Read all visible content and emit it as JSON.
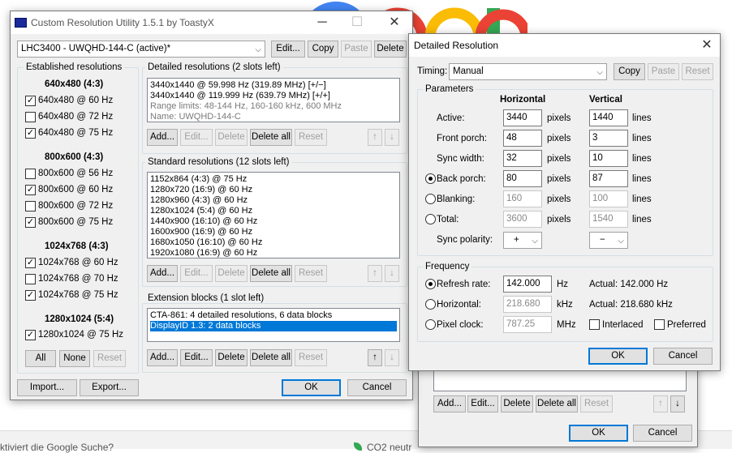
{
  "background": {
    "page_fragment_left": "ktiviert die Google Suche?",
    "page_fragment_right": "CO2 neutr"
  },
  "main": {
    "title": "Custom Resolution Utility 1.5.1 by ToastyX",
    "display": "LHC3400 - UWQHD-144-C (active)*",
    "top_buttons": {
      "edit": "Edit...",
      "copy": "Copy",
      "paste": "Paste",
      "delete": "Delete"
    },
    "established": {
      "label": "Established resolutions",
      "groups": [
        {
          "title": "640x480 (4:3)",
          "items": [
            {
              "label": "640x480 @ 60 Hz",
              "checked": true
            },
            {
              "label": "640x480 @ 72 Hz",
              "checked": false
            },
            {
              "label": "640x480 @ 75 Hz",
              "checked": true
            }
          ]
        },
        {
          "title": "800x600 (4:3)",
          "items": [
            {
              "label": "800x600 @ 56 Hz",
              "checked": false
            },
            {
              "label": "800x600 @ 60 Hz",
              "checked": true
            },
            {
              "label": "800x600 @ 72 Hz",
              "checked": false
            },
            {
              "label": "800x600 @ 75 Hz",
              "checked": true
            }
          ]
        },
        {
          "title": "1024x768 (4:3)",
          "items": [
            {
              "label": "1024x768 @ 60 Hz",
              "checked": true
            },
            {
              "label": "1024x768 @ 70 Hz",
              "checked": false
            },
            {
              "label": "1024x768 @ 75 Hz",
              "checked": true
            }
          ]
        },
        {
          "title": "1280x1024 (5:4)",
          "items": [
            {
              "label": "1280x1024 @ 75 Hz",
              "checked": true
            }
          ]
        }
      ],
      "buttons": {
        "all": "All",
        "none": "None",
        "reset": "Reset"
      }
    },
    "detailed": {
      "label": "Detailed resolutions (2 slots left)",
      "lines": [
        "3440x1440 @ 59.998 Hz (319.89 MHz) [+/−]",
        "3440x1440 @ 119.999 Hz (639.79 MHz) [+/+]"
      ],
      "gray_lines": [
        "Range limits: 48-144 Hz, 160-160 kHz, 600 MHz",
        "Name: UWQHD-144-C"
      ]
    },
    "standard": {
      "label": "Standard resolutions (12 slots left)",
      "lines": [
        "1152x864 (4:3) @ 75 Hz",
        "1280x720 (16:9) @ 60 Hz",
        "1280x960 (4:3) @ 60 Hz",
        "1280x1024 (5:4) @ 60 Hz",
        "1440x900 (16:10) @ 60 Hz",
        "1600x900 (16:9) @ 60 Hz",
        "1680x1050 (16:10) @ 60 Hz",
        "1920x1080 (16:9) @ 60 Hz"
      ]
    },
    "extension": {
      "label": "Extension blocks (1 slot left)",
      "lines": [
        "CTA-861: 4 detailed resolutions, 6 data blocks",
        "DisplayID 1.3: 2 data blocks"
      ]
    },
    "list_buttons": {
      "add": "Add...",
      "edit": "Edit...",
      "delete": "Delete",
      "delete_all": "Delete all",
      "reset": "Reset"
    },
    "bottom": {
      "import": "Import...",
      "export": "Export...",
      "ok": "OK",
      "cancel": "Cancel"
    }
  },
  "back_window": {
    "ok": "OK",
    "cancel": "Cancel"
  },
  "detail": {
    "title": "Detailed Resolution",
    "timing_label": "Timing:",
    "timing_value": "Manual",
    "copy": "Copy",
    "paste": "Paste",
    "reset": "Reset",
    "params": {
      "label": "Parameters",
      "col_h": "Horizontal",
      "col_v": "Vertical",
      "rows": [
        {
          "label": "Active:",
          "h": "3440",
          "hu": "pixels",
          "v": "1440",
          "vu": "lines",
          "enabled": true,
          "radio": false
        },
        {
          "label": "Front porch:",
          "h": "48",
          "hu": "pixels",
          "v": "3",
          "vu": "lines",
          "enabled": true,
          "radio": false
        },
        {
          "label": "Sync width:",
          "h": "32",
          "hu": "pixels",
          "v": "10",
          "vu": "lines",
          "enabled": true,
          "radio": false
        },
        {
          "label": "Back porch:",
          "h": "80",
          "hu": "pixels",
          "v": "87",
          "vu": "lines",
          "enabled": true,
          "radio": true,
          "selected": true
        },
        {
          "label": "Blanking:",
          "h": "160",
          "hu": "pixels",
          "v": "100",
          "vu": "lines",
          "enabled": false,
          "radio": true,
          "selected": false
        },
        {
          "label": "Total:",
          "h": "3600",
          "hu": "pixels",
          "v": "1540",
          "vu": "lines",
          "enabled": false,
          "radio": true,
          "selected": false
        }
      ],
      "sync_label": "Sync polarity:",
      "sync_h": "+",
      "sync_v": "−"
    },
    "freq": {
      "label": "Frequency",
      "rows": [
        {
          "label": "Refresh rate:",
          "value": "142.000",
          "unit": "Hz",
          "actual": "Actual: 142.000 Hz",
          "selected": true
        },
        {
          "label": "Horizontal:",
          "value": "218.680",
          "unit": "kHz",
          "actual": "Actual: 218.680 kHz",
          "selected": false
        },
        {
          "label": "Pixel clock:",
          "value": "787.25",
          "unit": "MHz",
          "selected": false
        }
      ],
      "interlaced": "Interlaced",
      "preferred": "Preferred"
    },
    "ok": "OK",
    "cancel": "Cancel"
  }
}
